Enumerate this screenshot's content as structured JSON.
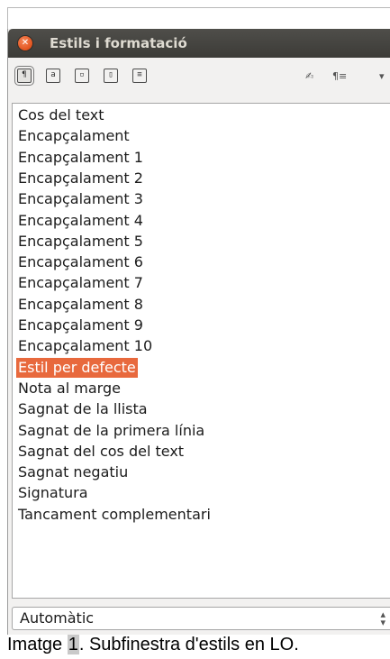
{
  "window": {
    "title": "Estils i formatació"
  },
  "toolbar": {
    "style_category_icons": [
      "paragraph-styles-icon",
      "character-styles-icon",
      "frame-styles-icon",
      "page-styles-icon",
      "list-styles-icon"
    ],
    "selected_category": "paragraph-styles-icon",
    "right_icons": [
      "fill-format-mode-icon",
      "new-style-from-selection-icon",
      "dropdown-arrow-icon"
    ]
  },
  "style_list": {
    "items": [
      "Cos del text",
      "Encapçalament",
      "Encapçalament 1",
      "Encapçalament 2",
      "Encapçalament 3",
      "Encapçalament 4",
      "Encapçalament 5",
      "Encapçalament 6",
      "Encapçalament 7",
      "Encapçalament 8",
      "Encapçalament 9",
      "Encapçalament 10",
      "Estil per defecte",
      "Nota al marge",
      "Sagnat de la llista",
      "Sagnat de la primera línia",
      "Sagnat del cos del text",
      "Sagnat negatiu",
      "Signatura",
      "Tancament complementari"
    ],
    "selected_index": 12
  },
  "filter": {
    "value": "Automàtic"
  },
  "caption": {
    "prefix": "Imatge ",
    "number": "1",
    "suffix": ". Subfinestra d'estils en LO."
  },
  "colors": {
    "titlebar": "#3c3b37",
    "close_button": "#e2531d",
    "selection": "#e8693d"
  }
}
